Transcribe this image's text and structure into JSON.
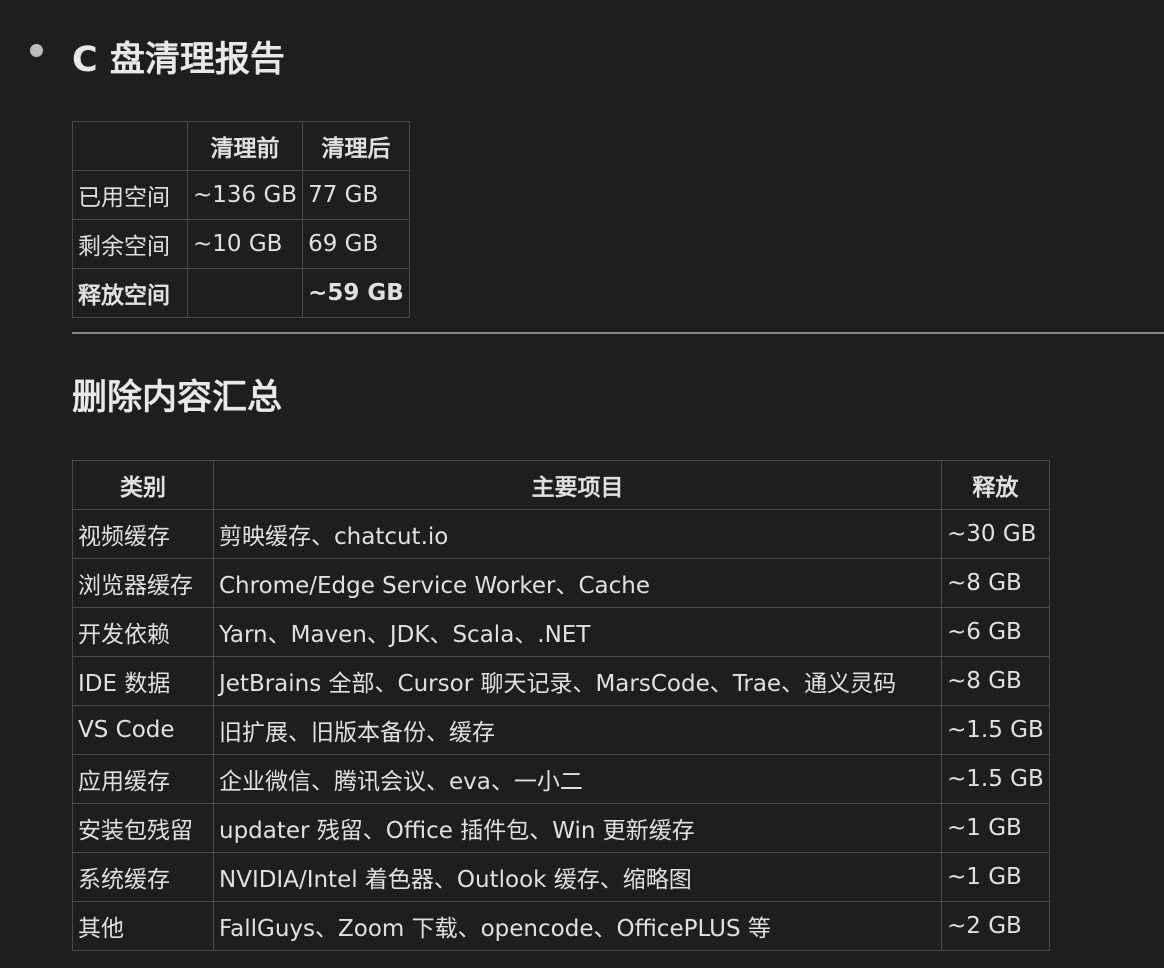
{
  "report": {
    "title": "C 盘清理报告",
    "summary_table": {
      "headers": [
        "",
        "清理前",
        "清理后"
      ],
      "rows": [
        {
          "label": "已用空间",
          "before": "~136 GB",
          "after": "77 GB"
        },
        {
          "label": "剩余空间",
          "before": "~10 GB",
          "after": "69 GB"
        },
        {
          "label": "释放空间",
          "before": "",
          "after": "~59 GB"
        }
      ]
    }
  },
  "deleted": {
    "title": "删除内容汇总",
    "headers": [
      "类别",
      "主要项目",
      "释放"
    ],
    "rows": [
      {
        "category": "视频缓存",
        "items": "剪映缓存、chatcut.io",
        "freed": "~30 GB"
      },
      {
        "category": "浏览器缓存",
        "items": "Chrome/Edge Service Worker、Cache",
        "freed": "~8 GB"
      },
      {
        "category": "开发依赖",
        "items": "Yarn、Maven、JDK、Scala、.NET",
        "freed": "~6 GB"
      },
      {
        "category": "IDE 数据",
        "items": "JetBrains 全部、Cursor 聊天记录、MarsCode、Trae、通义灵码",
        "freed": "~8 GB"
      },
      {
        "category": "VS Code",
        "items": "旧扩展、旧版本备份、缓存",
        "freed": "~1.5 GB"
      },
      {
        "category": "应用缓存",
        "items": "企业微信、腾讯会议、eva、一小二",
        "freed": "~1.5 GB"
      },
      {
        "category": "安装包残留",
        "items": "updater 残留、Office 插件包、Win 更新缓存",
        "freed": "~1 GB"
      },
      {
        "category": "系统缓存",
        "items": "NVIDIA/Intel 着色器、Outlook 缓存、缩略图",
        "freed": "~1 GB"
      },
      {
        "category": "其他",
        "items": "FallGuys、Zoom 下载、opencode、OfficePLUS 等",
        "freed": "~2 GB"
      }
    ]
  }
}
